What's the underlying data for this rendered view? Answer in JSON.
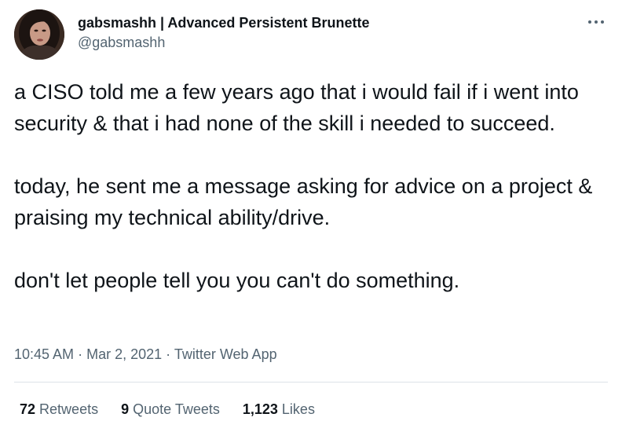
{
  "author": {
    "display_name": "gabsmashh | Advanced Persistent Brunette",
    "handle": "@gabsmashh",
    "avatar_icon": "profile-photo"
  },
  "tweet": {
    "paragraphs": [
      "a CISO told me a few years ago that i would fail if i went into security & that i had none of the skill i needed to succeed.",
      "today, he sent me a message asking for advice on a project & praising my technical ability/drive.",
      "don't let people tell you you can't do something."
    ]
  },
  "meta": {
    "time": "10:45 AM",
    "separator": "·",
    "date": "Mar 2, 2021",
    "source": "Twitter Web App"
  },
  "stats": {
    "retweets_count": "72",
    "retweets_label": "Retweets",
    "quotes_count": "9",
    "quotes_label": "Quote Tweets",
    "likes_count": "1,123",
    "likes_label": "Likes"
  },
  "colors": {
    "text_primary": "#0f1419",
    "text_secondary": "#536471",
    "divider": "#dde3e8"
  },
  "icons": {
    "more": "more-options-icon"
  }
}
